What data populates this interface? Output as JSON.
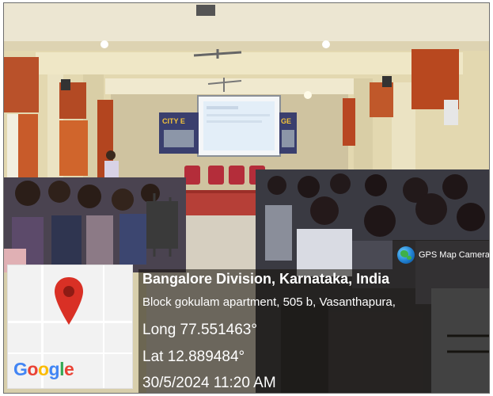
{
  "photo": {
    "description_icon": "classroom-photo"
  },
  "map": {
    "logo_parts": [
      "G",
      "o",
      "o",
      "g",
      "l",
      "e"
    ],
    "pin_icon": "map-pin-icon"
  },
  "gps_brand": {
    "label": "GPS Map Camera",
    "icon": "globe-icon"
  },
  "location": {
    "title": "Bangalore Division, Karnataka, India",
    "address": "Block gokulam apartment, 505 b, Vasanthapura,",
    "longitude": "Long 77.551463°",
    "latitude": "Lat 12.889484°",
    "datetime": "30/5/2024 11:20 AM"
  },
  "banner": {
    "left_text": "CITY E",
    "right_text": "GE"
  },
  "colors": {
    "accent_red_pin": "#d93025",
    "curtain": "#b84a22",
    "wall": "#e6dcb8",
    "overlay": "#1a140a"
  }
}
